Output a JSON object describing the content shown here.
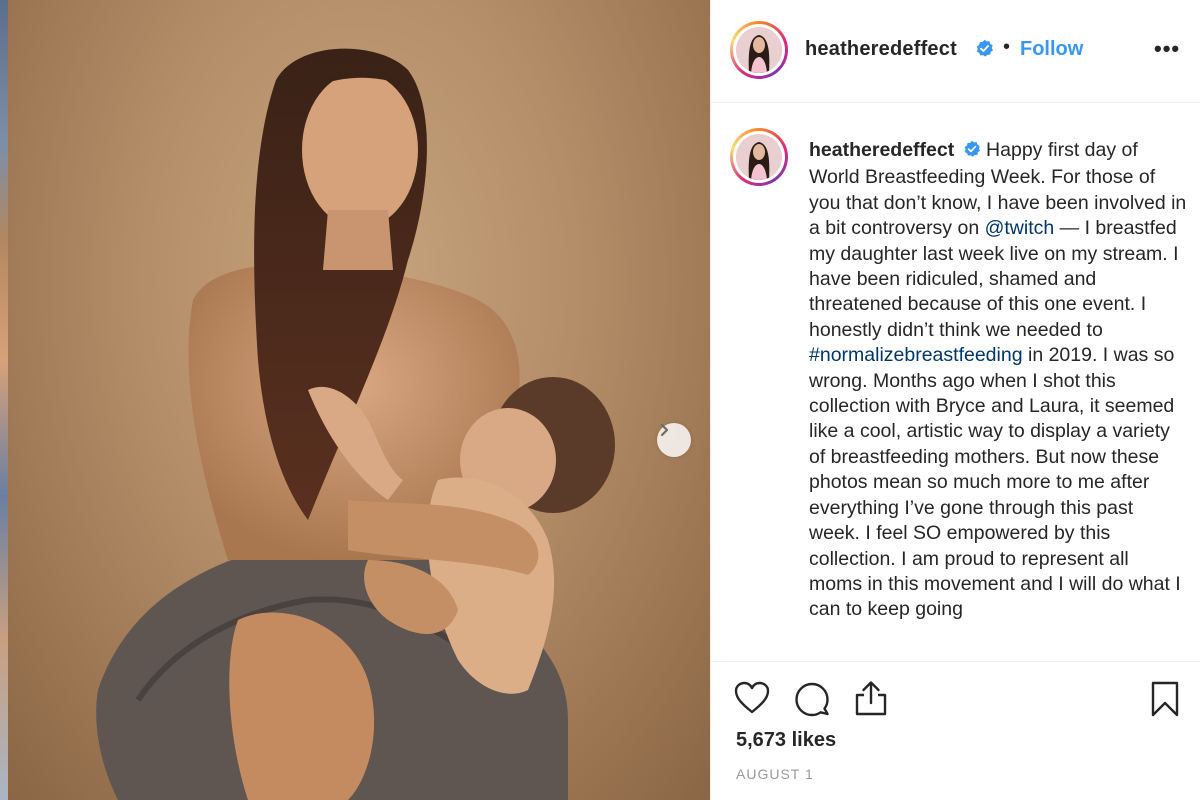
{
  "post": {
    "username": "heatheredeffect",
    "verified": true,
    "separator": "•",
    "follow_label": "Follow",
    "more_label": "•••",
    "caption_parts": [
      {
        "type": "text",
        "value": " Happy first day of World Breastfeeding Week. For those of you that don’t know, I have been involved in a bit controversy on "
      },
      {
        "type": "link",
        "value": "@twitch"
      },
      {
        "type": "text",
        "value": " — I breastfed my daughter last week live on my stream. I have been ridiculed, shamed and threatened because of this one event. I honestly didn’t think we needed to "
      },
      {
        "type": "link",
        "value": "#normalizebreastfeeding"
      },
      {
        "type": "text",
        "value": " in 2019. I was so wrong. Months ago when I shot this collection with Bryce and Laura, it seemed like a cool, artistic way to display a variety of breastfeeding mothers. But now these photos mean so much more to me after everything I’ve gone through this past week. I feel SO empowered by this collection. I am proud to represent all moms in this movement and I will do what I can to keep going"
      }
    ],
    "likes": "5,673 likes",
    "date": "AUGUST 1"
  },
  "icons": {
    "verified": "verified-badge-icon",
    "like": "heart-icon",
    "comment": "comment-bubble-icon",
    "share": "share-icon",
    "save": "bookmark-icon",
    "next": "chevron-right-icon"
  },
  "colors": {
    "link": "#003569",
    "follow": "#3897f0",
    "verified": "#3897f0",
    "muted": "#999999"
  }
}
